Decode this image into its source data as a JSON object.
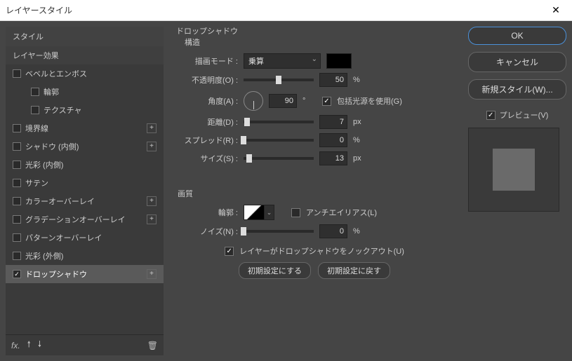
{
  "window": {
    "title": "レイヤースタイル"
  },
  "sidebar": {
    "header": "スタイル",
    "items": [
      {
        "label": "レイヤー効果",
        "checkbox": false,
        "plus": false,
        "section": true
      },
      {
        "label": "ベベルとエンボス",
        "checkbox": true,
        "checked": false,
        "plus": false
      },
      {
        "label": "輪郭",
        "checkbox": true,
        "checked": false,
        "plus": false,
        "indent": true
      },
      {
        "label": "テクスチャ",
        "checkbox": true,
        "checked": false,
        "plus": false,
        "indent": true
      },
      {
        "label": "境界線",
        "checkbox": true,
        "checked": false,
        "plus": true
      },
      {
        "label": "シャドウ (内側)",
        "checkbox": true,
        "checked": false,
        "plus": true
      },
      {
        "label": "光彩 (内側)",
        "checkbox": true,
        "checked": false,
        "plus": false
      },
      {
        "label": "サテン",
        "checkbox": true,
        "checked": false,
        "plus": false
      },
      {
        "label": "カラーオーバーレイ",
        "checkbox": true,
        "checked": false,
        "plus": true
      },
      {
        "label": "グラデーションオーバーレイ",
        "checkbox": true,
        "checked": false,
        "plus": true
      },
      {
        "label": "パターンオーバーレイ",
        "checkbox": true,
        "checked": false,
        "plus": false
      },
      {
        "label": "光彩 (外側)",
        "checkbox": true,
        "checked": false,
        "plus": false
      },
      {
        "label": "ドロップシャドウ",
        "checkbox": true,
        "checked": true,
        "plus": true,
        "selected": true
      }
    ]
  },
  "panel": {
    "title": "ドロップシャドウ",
    "structure_label": "構造",
    "blend_mode_label": "描画モード :",
    "blend_mode_value": "乗算",
    "opacity_label": "不透明度(O) :",
    "opacity_value": "50",
    "opacity_unit": "%",
    "angle_label": "角度(A) :",
    "angle_value": "90",
    "angle_unit": "°",
    "global_light_label": "包括光源を使用(G)",
    "distance_label": "距離(D) :",
    "distance_value": "7",
    "distance_unit": "px",
    "spread_label": "スプレッド(R) :",
    "spread_value": "0",
    "spread_unit": "%",
    "size_label": "サイズ(S) :",
    "size_value": "13",
    "size_unit": "px",
    "quality_label": "画質",
    "contour_label": "輪郭 :",
    "antialias_label": "アンチエイリアス(L)",
    "noise_label": "ノイズ(N) :",
    "noise_value": "0",
    "noise_unit": "%",
    "knockout_label": "レイヤーがドロップシャドウをノックアウト(U)",
    "make_default_label": "初期設定にする",
    "reset_default_label": "初期設定に戻す"
  },
  "buttons": {
    "ok": "OK",
    "cancel": "キャンセル",
    "new_style": "新規スタイル(W)...",
    "preview": "プレビュー(V)"
  }
}
